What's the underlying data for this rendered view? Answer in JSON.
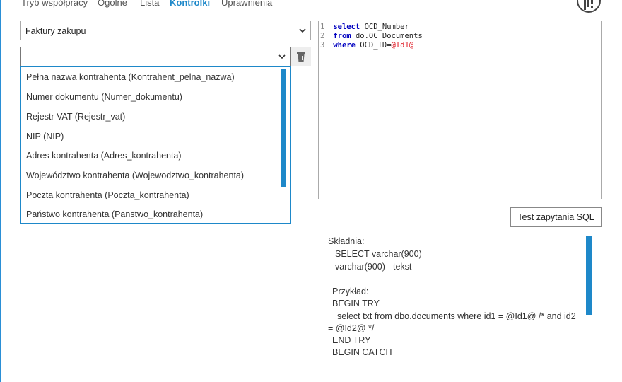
{
  "tabs": [
    {
      "label": "Tryb współpracy",
      "active": false
    },
    {
      "label": "Ogólne",
      "active": false
    },
    {
      "label": "Lista",
      "active": false
    },
    {
      "label": "Kontrolki",
      "active": true
    },
    {
      "label": "Uprawnienia",
      "active": false
    }
  ],
  "toolbar": {
    "icon": "settings-bars-icon"
  },
  "document_type_select": {
    "value": "Faktury zakupu"
  },
  "field_select": {
    "value": ""
  },
  "dropdown": {
    "options": [
      "Pełna nazwa kontrahenta (Kontrahent_pelna_nazwa)",
      "Numer dokumentu (Numer_dokumentu)",
      "Rejestr VAT (Rejestr_vat)",
      "NIP (NIP)",
      "Adres kontrahenta (Adres_kontrahenta)",
      "Województwo kontrahenta (Wojewodztwo_kontrahenta)",
      "Poczta kontrahenta (Poczta_kontrahenta)",
      "Państwo kontrahenta (Panstwo_kontrahenta)"
    ]
  },
  "sql_editor": {
    "lines": [
      {
        "n": "1",
        "kw": "select",
        "rest": "OCD_Number",
        "param": ""
      },
      {
        "n": "2",
        "kw": "from",
        "rest": "do.OC_Documents",
        "param": ""
      },
      {
        "n": "3",
        "kw": "where",
        "rest": "OCD_ID=",
        "param": "@Id1@"
      }
    ]
  },
  "test_button": {
    "label": "Test zapytania SQL"
  },
  "help_text": {
    "lines": [
      "Składnia:",
      "SELECT varchar(900)",
      "varchar(900) - tekst",
      "",
      "Przykład:",
      "BEGIN TRY",
      "select txt from dbo.documents where id1 = @Id1@ /* and id2",
      "= @Id2@ */",
      "END TRY",
      "BEGIN CATCH"
    ]
  },
  "colors": {
    "accent": "#1e88c9",
    "keyword": "#0000c0",
    "parameter": "#e0202a"
  }
}
